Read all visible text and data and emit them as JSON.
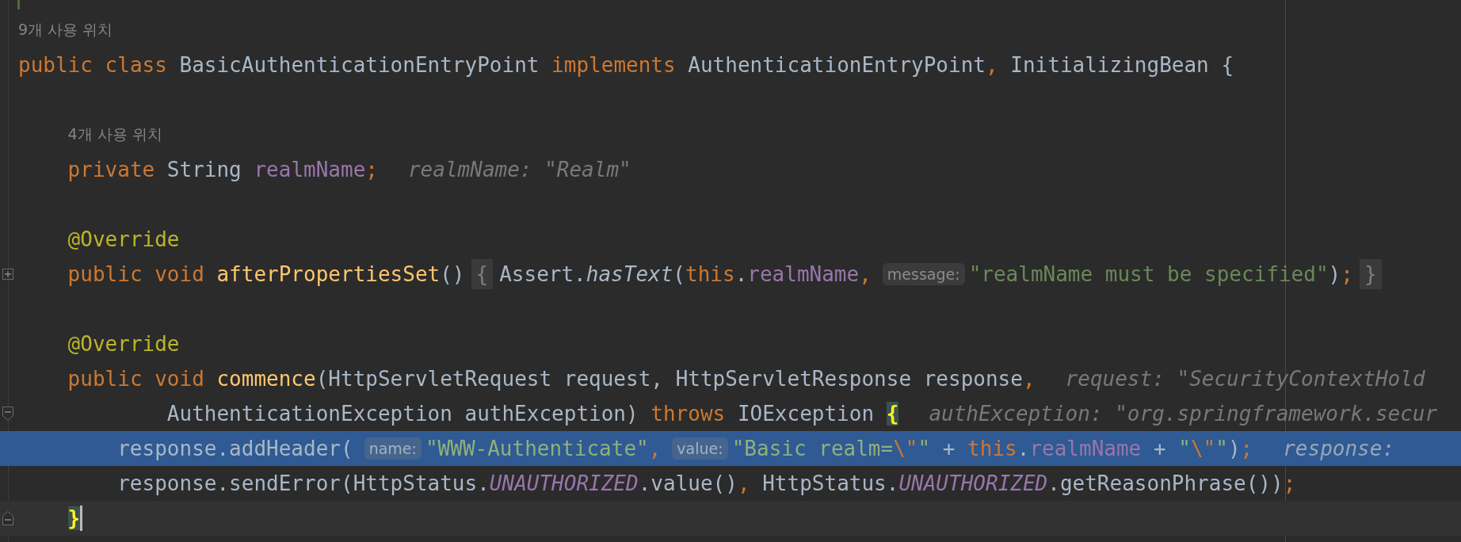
{
  "editor": {
    "lines": [
      {
        "kind": "usages",
        "text": "9개 사용 위치",
        "selected": false,
        "caret": false
      },
      {
        "kind": "code",
        "selected": false,
        "caret": false,
        "tokens": [
          {
            "kind": "keyword",
            "text": "public class "
          },
          {
            "kind": "plain",
            "text": "BasicAuthenticationEntryPoint "
          },
          {
            "kind": "keyword",
            "text": "implements "
          },
          {
            "kind": "plain",
            "text": "AuthenticationEntryPoint"
          },
          {
            "kind": "punct",
            "text": ", "
          },
          {
            "kind": "plain",
            "text": "InitializingBean {"
          }
        ],
        "children": [
          {
            "kind": "blank",
            "selected": false,
            "caret": false
          },
          {
            "kind": "usages",
            "text": "4개 사용 위치",
            "selected": false,
            "caret": false
          },
          {
            "kind": "code",
            "selected": false,
            "caret": false,
            "tokens": [
              {
                "kind": "keyword",
                "text": "private "
              },
              {
                "kind": "plain",
                "text": "String "
              },
              {
                "kind": "field",
                "text": "realmName"
              },
              {
                "kind": "punct",
                "text": ";"
              },
              {
                "kind": "value_hint",
                "text": "realmName: \"Realm\""
              }
            ]
          },
          {
            "kind": "blank",
            "selected": false,
            "caret": false
          },
          {
            "kind": "code",
            "selected": false,
            "caret": false,
            "tokens": [
              {
                "kind": "annotation",
                "text": "@Override"
              }
            ]
          },
          {
            "kind": "code",
            "fold_marker": {
              "kind": "expand"
            },
            "selected": false,
            "caret": false,
            "tokens": [
              {
                "kind": "keyword",
                "text": "public void "
              },
              {
                "kind": "method",
                "text": "afterPropertiesSet"
              },
              {
                "kind": "plain",
                "text": "()"
              },
              {
                "kind": "folded",
                "text": "{"
              },
              {
                "kind": "plain",
                "text": "Assert."
              },
              {
                "kind": "static_call",
                "text": "hasText"
              },
              {
                "kind": "plain",
                "text": "("
              },
              {
                "kind": "keyword",
                "text": "this"
              },
              {
                "kind": "plain",
                "text": "."
              },
              {
                "kind": "field",
                "text": "realmName"
              },
              {
                "kind": "punct",
                "text": ","
              },
              {
                "kind": "inlay",
                "text": "message:"
              },
              {
                "kind": "string",
                "text": "\"realmName must be specified\""
              },
              {
                "kind": "plain",
                "text": ")"
              },
              {
                "kind": "punct",
                "text": ";"
              },
              {
                "kind": "folded",
                "text": "}"
              }
            ]
          },
          {
            "kind": "blank",
            "selected": false,
            "caret": false
          },
          {
            "kind": "code",
            "selected": false,
            "caret": false,
            "tokens": [
              {
                "kind": "annotation",
                "text": "@Override"
              }
            ]
          },
          {
            "kind": "code",
            "selected": false,
            "caret": false,
            "tokens": [
              {
                "kind": "keyword",
                "text": "public void "
              },
              {
                "kind": "method",
                "text": "commence"
              },
              {
                "kind": "plain",
                "text": "(HttpServletRequest request, HttpServletResponse response"
              },
              {
                "kind": "punct",
                "text": ","
              },
              {
                "kind": "value_hint",
                "text": "request: \"SecurityContextHold"
              }
            ],
            "children": [
              {
                "kind": "continuation",
                "fold_marker": {
                  "kind": "start"
                },
                "selected": false,
                "caret": false,
                "tokens": [
                  {
                    "kind": "plain",
                    "text": "AuthenticationException authException) "
                  },
                  {
                    "kind": "keyword",
                    "text": "throws "
                  },
                  {
                    "kind": "plain",
                    "text": "IOException "
                  },
                  {
                    "kind": "brace",
                    "text": "{"
                  },
                  {
                    "kind": "value_hint",
                    "text": "authException: \"org.springframework.secur"
                  }
                ]
              },
              {
                "kind": "code",
                "selected": true,
                "caret": false,
                "tokens": [
                  {
                    "kind": "plain",
                    "text": "response.addHeader("
                  },
                  {
                    "kind": "inlay",
                    "text": "name:"
                  },
                  {
                    "kind": "string",
                    "text": "\"WWW-Authenticate\""
                  },
                  {
                    "kind": "punct",
                    "text": ","
                  },
                  {
                    "kind": "inlay",
                    "text": "value:"
                  },
                  {
                    "kind": "string",
                    "text": "\"Basic realm="
                  },
                  {
                    "kind": "escape",
                    "text": "\\\""
                  },
                  {
                    "kind": "string",
                    "text": "\""
                  },
                  {
                    "kind": "plain",
                    "text": " + "
                  },
                  {
                    "kind": "keyword",
                    "text": "this"
                  },
                  {
                    "kind": "plain",
                    "text": "."
                  },
                  {
                    "kind": "field",
                    "text": "realmName"
                  },
                  {
                    "kind": "plain",
                    "text": " + "
                  },
                  {
                    "kind": "string",
                    "text": "\""
                  },
                  {
                    "kind": "escape",
                    "text": "\\\""
                  },
                  {
                    "kind": "string",
                    "text": "\""
                  },
                  {
                    "kind": "plain",
                    "text": ")"
                  },
                  {
                    "kind": "punct",
                    "text": ";"
                  },
                  {
                    "kind": "value_hint",
                    "text": "response:"
                  }
                ]
              },
              {
                "kind": "code",
                "selected": false,
                "caret": false,
                "tokens": [
                  {
                    "kind": "plain",
                    "text": "response.sendError(HttpStatus."
                  },
                  {
                    "kind": "static_field",
                    "text": "UNAUTHORIZED"
                  },
                  {
                    "kind": "plain",
                    "text": ".value()"
                  },
                  {
                    "kind": "punct",
                    "text": ","
                  },
                  {
                    "kind": "plain",
                    "text": " HttpStatus."
                  },
                  {
                    "kind": "static_field",
                    "text": "UNAUTHORIZED"
                  },
                  {
                    "kind": "plain",
                    "text": ".getReasonPhrase())"
                  },
                  {
                    "kind": "punct",
                    "text": ";"
                  }
                ]
              }
            ]
          },
          {
            "kind": "code",
            "fold_marker": {
              "kind": "end"
            },
            "selected": false,
            "caret": true,
            "tokens": [
              {
                "kind": "brace",
                "text": "}"
              }
            ]
          }
        ]
      }
    ]
  }
}
